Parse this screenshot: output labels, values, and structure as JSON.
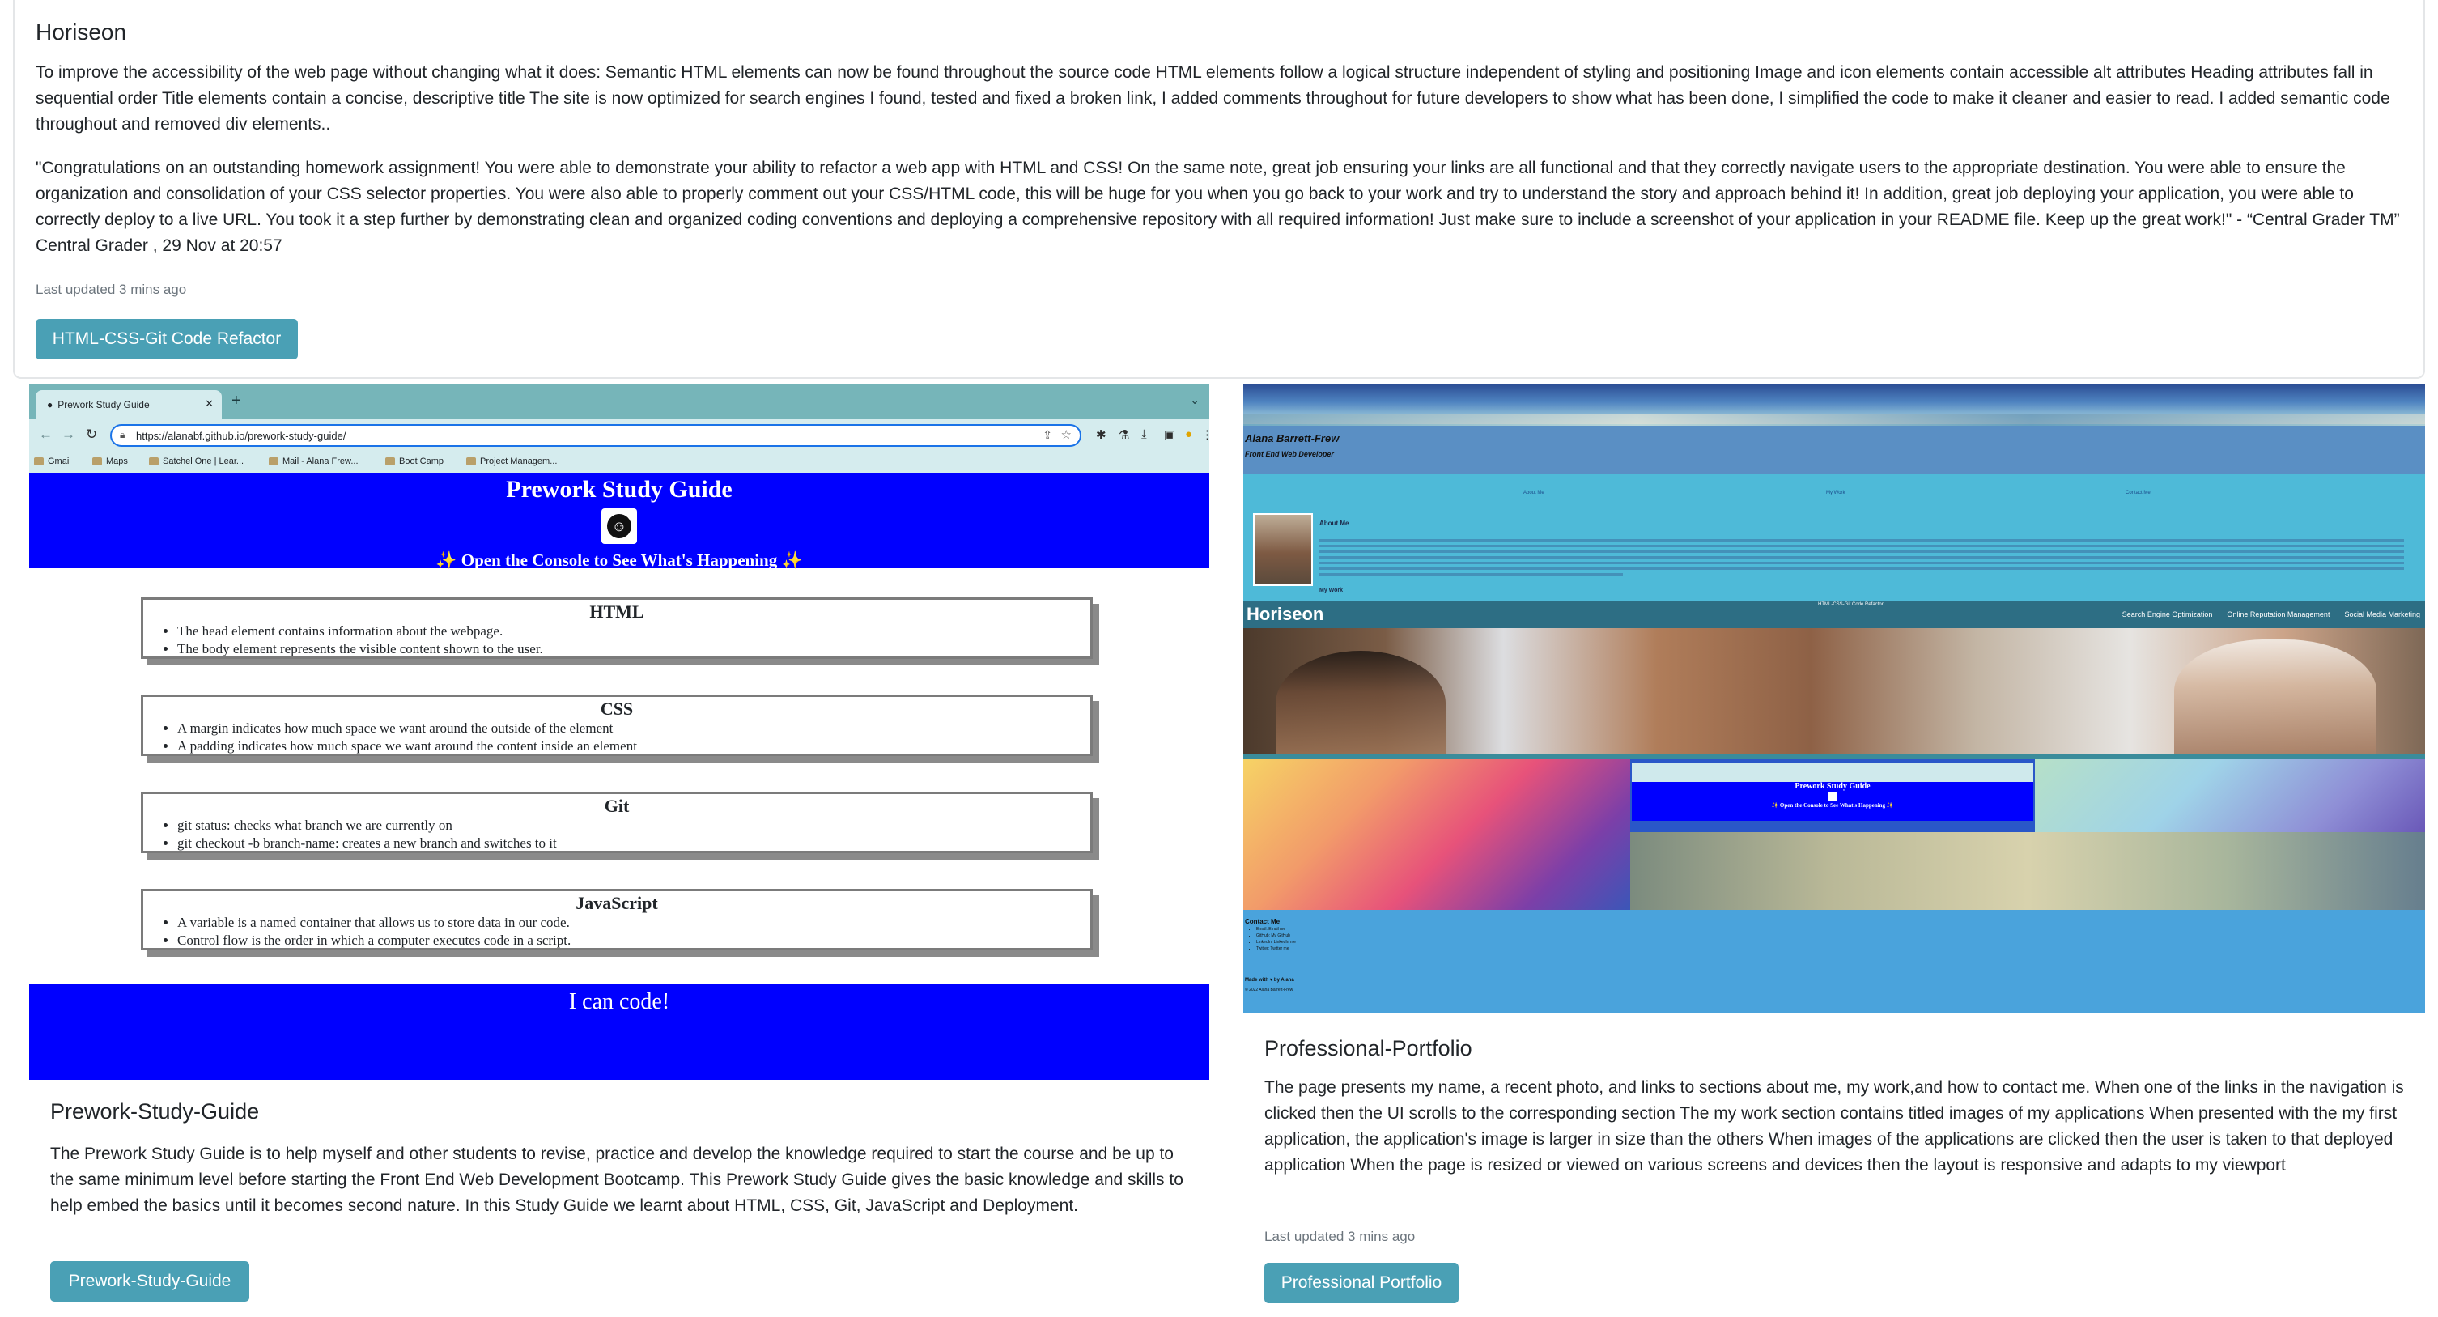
{
  "top_card": {
    "title": "Horiseon",
    "paragraph1": "To improve the accessibility of the web page without changing what it does: Semantic HTML elements can now be found throughout the source code HTML elements follow a logical structure independent of styling and positioning Image and icon elements contain accessible alt attributes Heading attributes fall in sequential order Title elements contain a concise, descriptive title The site is now optimized for search engines I found, tested and fixed a broken link, I added comments throughout for future developers to show what has been done, I simplified the code to make it cleaner and easier to read. I added semantic code throughout and removed div elements..",
    "paragraph2": "\"Congratulations on an outstanding homework assignment! You were able to demonstrate your ability to refactor a web app with HTML and CSS! On the same note, great job ensuring your links are all functional and that they correctly navigate users to the appropriate destination. You were able to ensure the organization and consolidation of your CSS selector properties. You were also able to properly comment out your CSS/HTML code, this will be huge for you when you go back to your work and try to understand the story and approach behind it! In addition, great job deploying your application, you were able to correctly deploy to a live URL. You took it a step further by demonstrating clean and organized coding conventions and deploying a comprehensive repository with all required information! Just make sure to include a screenshot of your application in your README file. Keep up the great work!\" - “Central Grader TM” Central Grader , 29 Nov at 20:57",
    "updated": "Last updated 3 mins ago",
    "button": "HTML-CSS-Git Code Refactor"
  },
  "prework_shot": {
    "tab_title": "Prework Study Guide",
    "url": "https://alanabf.github.io/prework-study-guide/",
    "bookmarks": [
      "Gmail",
      "Maps",
      "Satchel One | Lear...",
      "Mail - Alana Frew...",
      "Boot Camp",
      "Project Managem..."
    ],
    "header_title": "Prework Study Guide",
    "header_sub": "✨ Open the Console to See What's Happening ✨",
    "boxes": [
      {
        "title": "HTML",
        "items": [
          "The head element contains information about the webpage.",
          "The body element represents the visible content shown to the user."
        ]
      },
      {
        "title": "CSS",
        "items": [
          "A margin indicates how much space we want around the outside of the element",
          "A padding indicates how much space we want around the content inside an element"
        ]
      },
      {
        "title": "Git",
        "items": [
          "git status: checks what branch we are currently on",
          "git checkout -b branch-name: creates a new branch and switches to it"
        ]
      },
      {
        "title": "JavaScript",
        "items": [
          "A variable is a named container that allows us to store data in our code.",
          "Control flow is the order in which a computer executes code in a script."
        ]
      }
    ],
    "footer": "I can code!"
  },
  "portfolio_shot": {
    "name": "Alana Barrett-Frew",
    "role": "Front End Web Developer",
    "nav": [
      "About Me",
      "My Work",
      "Contact Me"
    ],
    "about_title": "About Me",
    "my_work": "My Work",
    "horiseon_logo": "Horiseon",
    "horiseon_mid": "HTML-CSS-Git Code Refactor",
    "horiseon_links": [
      "Search Engine Optimization",
      "Online Reputation Management",
      "Social Media Marketing"
    ],
    "mini_prework_title": "Prework Study Guide",
    "mini_prework_sub": "✨ Open the Console to See What's Happening ✨",
    "contact_title": "Contact Me",
    "contact_items": [
      "Email: Email me",
      "GitHub: My GitHub",
      "LinkedIn: LinkedIn me",
      "Twitter: Twitter me"
    ],
    "built_with": "Made with ♥ by Alana",
    "copyright": "© 2022 Alana Barrett-Frew"
  },
  "prework_card": {
    "title": "Prework-Study-Guide",
    "text": "The Prework Study Guide is to help myself and other students to revise, practice and develop the knowledge required to start the course and be up to the same minimum level before starting the Front End Web Development Bootcamp. This Prework Study Guide gives the basic knowledge and skills to help embed the basics until it becomes second nature. In this Study Guide we learnt about HTML, CSS, Git, JavaScript and Deployment.",
    "button": "Prework-Study-Guide"
  },
  "portfolio_card": {
    "title": "Professional-Portfolio",
    "text": "The page presents my name, a recent photo, and links to sections about me, my work,and how to contact me. When one of the links in the navigation is clicked then the UI scrolls to the corresponding section The my work section contains titled images of my applications When presented with the my first application, the application's image is larger in size than the others When images of the applications are clicked then the user is taken to that deployed application When the page is resized or viewed on various screens and devices then the layout is responsive and adapts to my viewport",
    "updated": "Last updated 3 mins ago",
    "button": "Professional Portfolio"
  },
  "colors": {
    "button_bg": "#4aa0b5",
    "prework_blue": "#0000ff",
    "portfolio_bg": "#4ebad8"
  }
}
